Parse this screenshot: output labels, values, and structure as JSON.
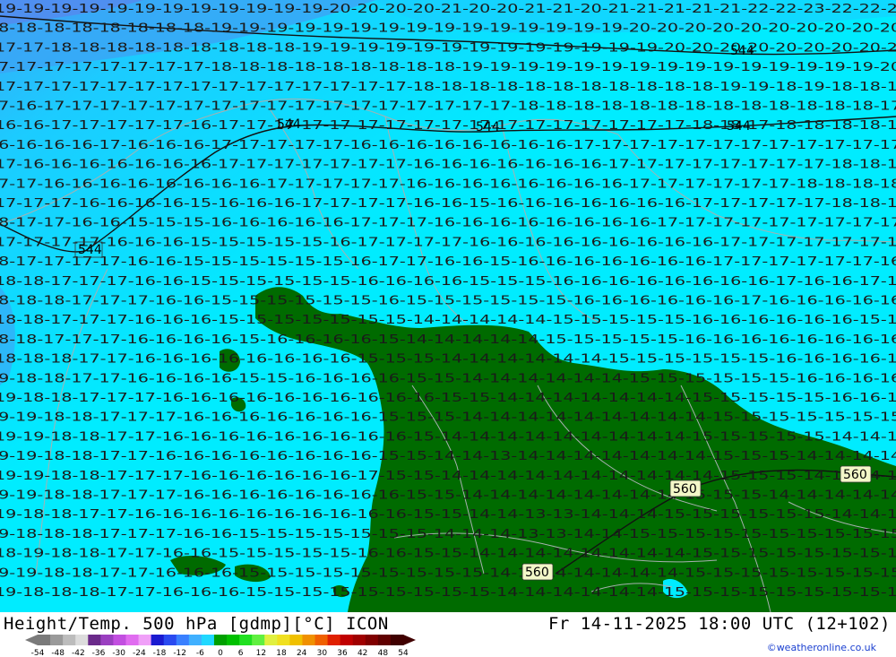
{
  "map": {
    "background_colors": {
      "ocean_mid": "#00ecff",
      "ocean_cool": "#1ccbff",
      "ocean_cold": "#3aa6f6",
      "ocean_coldest": "#4f8ff0",
      "land": "#006b00"
    },
    "isotherm_rows": [
      "19-19-19-19-19-19-19-19-19-19-19-19-20-20-20-20-21-20-20-21-21-20-21-21-21-21-21-22-22-23-22-22-23",
      "18-18-18-18-18-18-18-18-19-19-19-19-19-19-19-19-19-19-19-19-19-19-19-20-20-20-20-20-20-20-20-20-20",
      "17-17-18-18-18-18-18-18-18-18-18-19-19-19-19-19-19-19-19-19-19-19-19-19-20-20-20-20-20-20-20-20-20",
      "17-17-17-17-17-17-17-17-18-18-18-18-18-18-18-18-18-19-19-19-19-19-19-19-19-19-19-19-19-19-19-19-20",
      "17-17-17-17-17-17-17-17-17-17-17-17-17-17-17-18-18-18-18-18-18-18-18-18-18-18-19-19-18-19-18-18-18",
      "17-16-17-17-17-17-17-17-17-17-17-17-17-17-17-17-17-17-17-18-18-18-18-18-18-18-18-18-18-18-18-18-17",
      "16-16-17-17-17-17-17-16-17-17-17-17-17-17-17-17-17-17-17-17-17-17-17-17-17-18-18-17-18-18-18-18-18",
      "16-16-16-16-17-16-16-16-17-17-17-17-17-16-16-16-16-16-16-16-16-17-17-17-17-17-17-17-17-17-17-17-17",
      "17-16-16-16-16-16-16-16-17-17-17-17-17-17-17-16-16-16-16-16-16-16-17-17-17-17-17-17-17-17-18-18-18",
      "17-17-16-16-16-16-16-16-16-16-17-17-17-17-17-16-16-16-16-16-16-16-16-17-17-17-17-17-17-18-18-18-18",
      "17-17-17-16-16-16-16-15-16-16-16-17-17-17-17-16-16-15-16-16-16-16-16-16-16-17-17-17-17-17-18-18-18",
      "18-17-17-16-16-15-15-15-16-16-16-16-16-17-17-17-16-16-16-16-16-16-16-16-17-17-17-17-17-17-17-17-17",
      "17-17-17-17-16-16-16-15-15-15-15-15-16-17-17-17-17-16-16-16-16-16-16-16-16-16-17-17-17-17-17-17-17",
      "18-17-17-17-17-16-16-15-15-15-15-15-15-16-17-17-16-16-15-16-16-16-16-16-16-16-17-17-17-17-17-17-16",
      "18-18-17-17-17-16-16-15-15-15-15-15-15-16-16-16-16-15-15-15-16-16-16-16-16-16-16-16-17-16-16-17-17",
      "18-18-18-17-17-17-16-16-15-15-15-15-15-15-16-15-15-15-15-15-15-16-16-16-16-16-16-17-16-16-16-16-16",
      "18-18-17-17-17-16-16-16-15-15-15-15-15-15-15-14-14-14-14-14-15-15-15-15-15-16-16-16-16-16-16-15-16",
      "18-18-17-17-17-16-16-16-16-15-16-16-16-16-15-14-14-14-14-14-15-15-15-15-15-16-16-16-16-16-16-16-16",
      "18-18-18-17-17-16-16-16-16-16-16-16-16-15-15-15-14-14-14-14-14-14-15-15-15-15-15-15-16-16-16-16-16",
      "19-18-18-17-17-16-16-16-16-15-15-16-16-16-16-15-15-14-14-14-14-14-14-15-15-15-15-15-15-16-16-16-16",
      "19-18-18-17-17-17-16-16-16-16-16-16-16-16-16-16-15-15-14-14-14-14-14-14-14-15-15-15-15-15-16-16-16",
      "19-19-18-18-17-17-17-16-16-16-16-16-16-16-15-15-15-14-14-14-14-14-14-14-14-14-15-15-15-15-15-15-15",
      "19-19-18-18-17-17-16-16-16-16-16-16-16-16-16-15-14-14-14-14-14-14-14-14-14-15-15-15-15-15-14-14-14",
      "19-19-18-18-17-17-16-16-16-16-16-16-16-16-15-15-14-14-13-14-14-14-14-14-14-14-15-15-15-14-14-14-14",
      "19-19-18-18-17-17-17-16-16-16-16-16-16-17-15-15-14-14-14-14-14-14-14-14-14-14-15-15-15-14-14-14-14",
      "19-19-18-18-17-17-17-16-16-16-16-16-16-16-16-15-15-14-14-14-14-14-14-14-14-15-15-15-14-14-14-14-14",
      "19-18-18-17-17-16-16-16-16-16-16-16-16-16-16-15-15-14-14-13-13-14-14-14-15-15-15-15-15-15-14-14-15",
      "19-18-18-18-17-17-17-16-16-15-15-15-15-15-15-15-14-14-14-13-13-14-14-15-15-15-15-15-15-15-15-15-15",
      "18-19-18-18-17-17-16-16-15-15-15-15-15-16-16-15-15-14-14-14-14-14-14-14-14-15-15-15-15-15-15-15-15",
      "19-19-18-18-17-17-16-16-16-15-15-15-15-15-15-15-15-15-14-14-14-14-14-14-14-15-15-15-15-15-15-15-15",
      "19-18-18-18-17-17-16-16-16-15-15-15-15-15-15-15-15-15-14-14-14-14-14-14-15-15-15-15-15-15-15-15-15"
    ],
    "height_labels": [
      {
        "id": "h1",
        "text": "544"
      },
      {
        "id": "h2",
        "text": "544"
      },
      {
        "id": "h3",
        "text": "544"
      },
      {
        "id": "h4",
        "text": "544"
      },
      {
        "id": "h5",
        "text": "544"
      },
      {
        "id": "h6",
        "text": "560"
      },
      {
        "id": "h7",
        "text": "560"
      },
      {
        "id": "h8",
        "text": "560"
      }
    ]
  },
  "footer": {
    "title": "Height/Temp. 500 hPa [gdmp][°C] ICON",
    "datetime": "Fr 14-11-2025 18:00 UTC (12+102)",
    "credit": "©weatheronline.co.uk",
    "colorbar": {
      "ticks": [
        "-54",
        "-48",
        "-42",
        "-36",
        "-30",
        "-24",
        "-18",
        "-12",
        "-6",
        "0",
        "6",
        "12",
        "18",
        "24",
        "30",
        "36",
        "42",
        "48",
        "54"
      ],
      "colors": [
        "#7a7a7a",
        "#9a9a9a",
        "#bcbcbc",
        "#dcdcdc",
        "#6a2a8a",
        "#9a3fc0",
        "#c24fe0",
        "#e06cf0",
        "#f0a0f8",
        "#1a1ad0",
        "#2a4af0",
        "#3a80ff",
        "#40b0ff",
        "#20d8ff",
        "#00a000",
        "#00c000",
        "#20e020",
        "#60f040",
        "#e0f040",
        "#f0e020",
        "#f0c000",
        "#f09000",
        "#f06000",
        "#e02000",
        "#c00000",
        "#a00000",
        "#800000",
        "#600000",
        "#400000"
      ]
    }
  }
}
